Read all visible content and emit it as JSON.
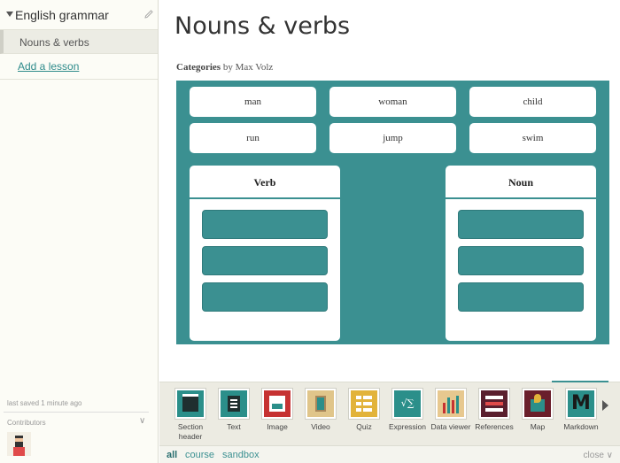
{
  "sidebar": {
    "course_title": "English grammar",
    "lessons": [
      {
        "label": "Nouns & verbs",
        "selected": true
      }
    ],
    "add_lesson_label": "Add a lesson",
    "last_saved": "last saved 1 minute ago",
    "contributors_label": "Contributors"
  },
  "main": {
    "title": "Nouns & verbs",
    "block_type": "Categories",
    "byline_by": "by Max Volz",
    "activity": {
      "words": [
        "man",
        "woman",
        "child",
        "run",
        "jump",
        "swim"
      ],
      "categories": [
        {
          "name": "Verb",
          "slot_count": 3
        },
        {
          "name": "Noun",
          "slot_count": 3
        }
      ]
    }
  },
  "toolbar": {
    "tools": [
      {
        "label": "Section header",
        "icon": "section-header-icon",
        "color": "#2b8f8a"
      },
      {
        "label": "Text",
        "icon": "text-icon",
        "color": "#2b8f8a"
      },
      {
        "label": "Image",
        "icon": "image-icon",
        "color": "#c63232"
      },
      {
        "label": "Video",
        "icon": "video-icon",
        "color": "#e0c58a"
      },
      {
        "label": "Quiz",
        "icon": "quiz-icon",
        "color": "#e2b33a"
      },
      {
        "label": "Expression",
        "icon": "expression-icon",
        "color": "#2b8f8a"
      },
      {
        "label": "Data viewer",
        "icon": "data-viewer-icon",
        "color": "#e7c88f"
      },
      {
        "label": "References",
        "icon": "references-icon",
        "color": "#5a1f2e"
      },
      {
        "label": "Map",
        "icon": "map-icon",
        "color": "#6a1f2b"
      },
      {
        "label": "Markdown",
        "icon": "markdown-icon",
        "color": "#2b8f8a"
      }
    ]
  },
  "filters": {
    "tabs": [
      "all",
      "course",
      "sandbox"
    ],
    "active": "all",
    "close_label": "close"
  },
  "colors": {
    "accent": "#3b9091",
    "sidebar_bg": "#fcfcf6",
    "toolbar_bg": "#ecebe2"
  }
}
